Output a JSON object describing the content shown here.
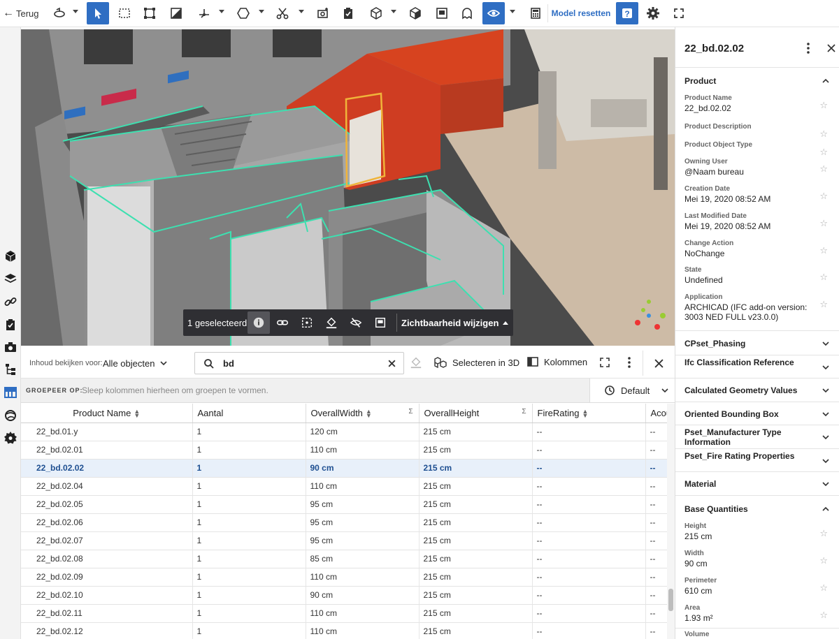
{
  "toolbar": {
    "back_label": "Terug",
    "reset_label": "Model resetten",
    "accent": "#2f6ec3"
  },
  "viewport": {
    "selection": {
      "count_label": "1 geselecteerd",
      "visibility_label": "Zichtbaarheid wijzigen"
    }
  },
  "grid": {
    "view_for_label": "Inhoud bekijken voor:",
    "view_for_value": "Alle objecten",
    "search_value": "bd",
    "select_3d_label": "Selecteren in 3D",
    "columns_label": "Kolommen",
    "group_by_label": "GROEPEER OP:",
    "group_by_hint": "Sleep kolommen hierheen om groepen te vormen.",
    "preset_label": "Default",
    "headers": [
      "Product Name",
      "Aantal",
      "OverallWidth",
      "OverallHeight",
      "FireRating",
      "Acous"
    ],
    "rows": [
      [
        "22_bd.01.y",
        "1",
        "120 cm",
        "215 cm",
        "--",
        "--"
      ],
      [
        "22_bd.02.01",
        "1",
        "110 cm",
        "215 cm",
        "--",
        "--"
      ],
      [
        "22_bd.02.02",
        "1",
        "90 cm",
        "215 cm",
        "--",
        "--"
      ],
      [
        "22_bd.02.04",
        "1",
        "110 cm",
        "215 cm",
        "--",
        "--"
      ],
      [
        "22_bd.02.05",
        "1",
        "95 cm",
        "215 cm",
        "--",
        "--"
      ],
      [
        "22_bd.02.06",
        "1",
        "95 cm",
        "215 cm",
        "--",
        "--"
      ],
      [
        "22_bd.02.07",
        "1",
        "95 cm",
        "215 cm",
        "--",
        "--"
      ],
      [
        "22_bd.02.08",
        "1",
        "85 cm",
        "215 cm",
        "--",
        "--"
      ],
      [
        "22_bd.02.09",
        "1",
        "110 cm",
        "215 cm",
        "--",
        "--"
      ],
      [
        "22_bd.02.10",
        "1",
        "90 cm",
        "215 cm",
        "--",
        "--"
      ],
      [
        "22_bd.02.11",
        "1",
        "110 cm",
        "215 cm",
        "--",
        "--"
      ],
      [
        "22_bd.02.12",
        "1",
        "110 cm",
        "215 cm",
        "--",
        "--"
      ]
    ],
    "selected_row": 2
  },
  "panel": {
    "title": "22_bd.02.02",
    "product_section": "Product",
    "product_props": [
      {
        "k": "Product Name",
        "v": "22_bd.02.02"
      },
      {
        "k": "Product Description",
        "v": ""
      },
      {
        "k": "Product Object Type",
        "v": ""
      },
      {
        "k": "Owning User",
        "v": "@Naam bureau"
      },
      {
        "k": "Creation Date",
        "v": "Mei 19, 2020 08:52 AM"
      },
      {
        "k": "Last Modified Date",
        "v": "Mei 19, 2020 08:52 AM"
      },
      {
        "k": "Change Action",
        "v": "NoChange"
      },
      {
        "k": "State",
        "v": "Undefined"
      },
      {
        "k": "Application",
        "v": "ARCHICAD (IFC add-on version: 3003 NED FULL v23.0.0)"
      }
    ],
    "sections": [
      "CPset_Phasing",
      "Ifc Classification Reference",
      "Calculated Geometry Values",
      "Oriented Bounding Box",
      "Pset_Manufacturer Type Information",
      "Pset_Fire Rating Properties",
      "Material"
    ],
    "quantities_section": "Base Quantities",
    "quantity_props": [
      {
        "k": "Height",
        "v": "215 cm"
      },
      {
        "k": "Width",
        "v": "90 cm"
      },
      {
        "k": "Perimeter",
        "v": "610 cm"
      },
      {
        "k": "Area",
        "v": "1.93 m²"
      },
      {
        "k": "Volume",
        "v": ""
      }
    ]
  }
}
